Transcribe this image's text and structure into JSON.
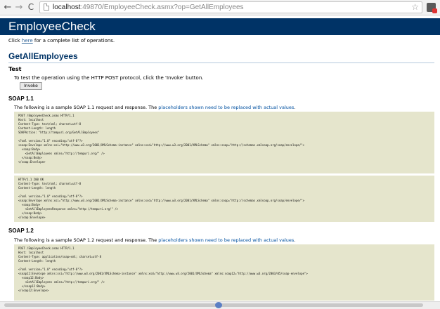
{
  "browser": {
    "back_glyph": "←",
    "forward_glyph": "→",
    "reload_glyph": "C",
    "url_host": "localhost",
    "url_rest": ":49870/EmployeeCheck.asmx?op=GetAllEmployees",
    "star_glyph": "☆",
    "icons": [
      "back-icon",
      "forward-icon",
      "reload-icon",
      "page-icon",
      "star-icon",
      "extension-icon"
    ]
  },
  "page": {
    "banner_title": "EmployeeCheck",
    "intro_before": "Click ",
    "intro_link": "here",
    "intro_after": " for a complete list of operations.",
    "operation_title": "GetAllEmployees",
    "test_heading": "Test",
    "test_text": "To test the operation using the HTTP POST protocol, click the 'Invoke' button.",
    "invoke_label": "Invoke",
    "colors": {
      "banner": "#003366",
      "title": "#003366",
      "code_background": "#e5e5cc",
      "link": "#336699"
    }
  },
  "soap11": {
    "heading": "SOAP 1.1",
    "desc_before": "The following is a sample SOAP 1.1 request and response. The ",
    "desc_placeholders": "placeholders",
    "desc_mid": " shown need to be replaced with actual ",
    "desc_values": "values",
    "desc_end": ".",
    "request": "POST /EmployeeCheck.asmx HTTP/1.1\nHost: localhost\nContent-Type: text/xml; charset=utf-8\nContent-Length: length\nSOAPAction: \"http://tempuri.org/GetAllEmployees\"\n\n<?xml version=\"1.0\" encoding=\"utf-8\"?>\n<soap:Envelope xmlns:xsi=\"http://www.w3.org/2001/XMLSchema-instance\" xmlns:xsd=\"http://www.w3.org/2001/XMLSchema\" xmlns:soap=\"http://schemas.xmlsoap.org/soap/envelope/\">\n  <soap:Body>\n    <GetAllEmployees xmlns=\"http://tempuri.org/\" />\n  </soap:Body>\n</soap:Envelope>",
    "response": "HTTP/1.1 200 OK\nContent-Type: text/xml; charset=utf-8\nContent-Length: length\n\n<?xml version=\"1.0\" encoding=\"utf-8\"?>\n<soap:Envelope xmlns:xsi=\"http://www.w3.org/2001/XMLSchema-instance\" xmlns:xsd=\"http://www.w3.org/2001/XMLSchema\" xmlns:soap=\"http://schemas.xmlsoap.org/soap/envelope/\">\n  <soap:Body>\n    <GetAllEmployeesResponse xmlns=\"http://tempuri.org/\" />\n  </soap:Body>\n</soap:Envelope>"
  },
  "soap12": {
    "heading": "SOAP 1.2",
    "desc_before": "The following is a sample SOAP 1.2 request and response. The ",
    "desc_placeholders": "placeholders",
    "desc_mid": " shown need to be replaced with actual ",
    "desc_values": "values",
    "desc_end": ".",
    "request": "POST /EmployeeCheck.asmx HTTP/1.1\nHost: localhost\nContent-Type: application/soap+xml; charset=utf-8\nContent-Length: length\n\n<?xml version=\"1.0\" encoding=\"utf-8\"?>\n<soap12:Envelope xmlns:xsi=\"http://www.w3.org/2001/XMLSchema-instance\" xmlns:xsd=\"http://www.w3.org/2001/XMLSchema\" xmlns:soap12=\"http://www.w3.org/2003/05/soap-envelope\">\n  <soap12:Body>\n    <GetAllEmployees xmlns=\"http://tempuri.org/\" />\n  </soap12:Body>\n</soap12:Envelope>"
  }
}
